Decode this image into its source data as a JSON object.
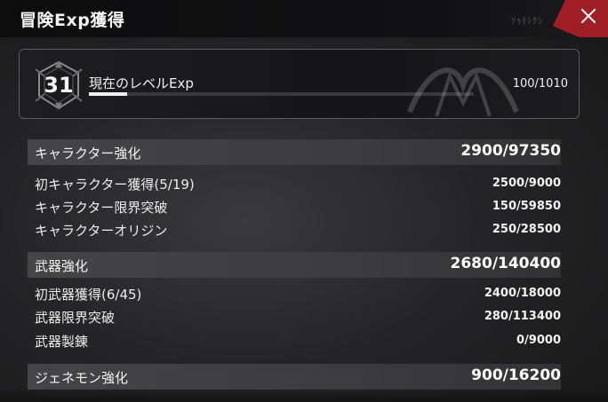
{
  "window": {
    "title": "冒険Exp獲得",
    "deco_text": "ｿｩﾘｼｸｼ"
  },
  "level": {
    "number": "31",
    "label": "現在のレベルExp",
    "value": "100/1010",
    "progress": 0.099
  },
  "sections": [
    {
      "title": "キャラクター強化",
      "value": "2900/97350",
      "rows": [
        {
          "label": "初キャラクター獲得(5/19)",
          "value": "2500/9000"
        },
        {
          "label": "キャラクター限界突破",
          "value": "150/59850"
        },
        {
          "label": "キャラクターオリジン",
          "value": "250/28500"
        }
      ]
    },
    {
      "title": "武器強化",
      "value": "2680/140400",
      "rows": [
        {
          "label": "初武器獲得(6/45)",
          "value": "2400/18000"
        },
        {
          "label": "武器限界突破",
          "value": "280/113400"
        },
        {
          "label": "武器製錬",
          "value": "0/9000"
        }
      ]
    },
    {
      "title": "ジェネモン強化",
      "value": "900/16200",
      "rows": []
    }
  ],
  "colors": {
    "close_button": "#a01f26",
    "progress_fill": "#f0f0f0"
  }
}
